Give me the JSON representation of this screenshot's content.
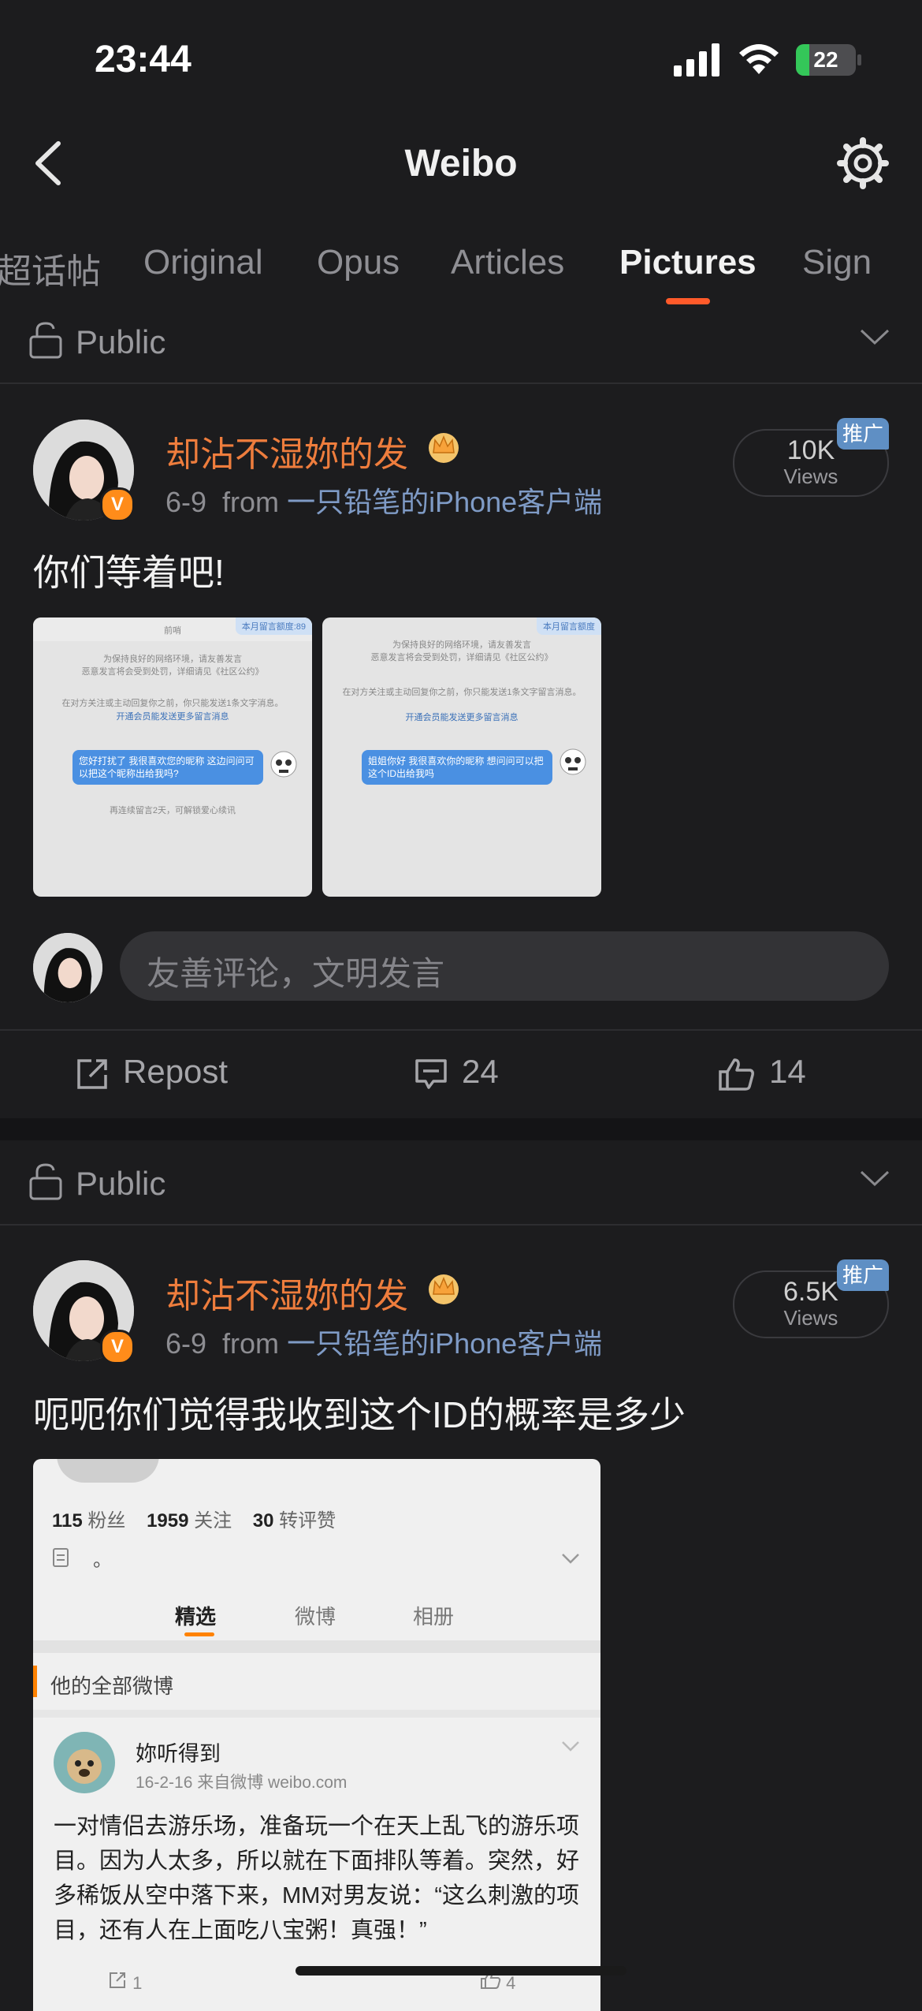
{
  "status_bar": {
    "time": "23:44",
    "battery": "22",
    "battery_level": 0.22
  },
  "nav": {
    "title": "Weibo"
  },
  "tabs": [
    {
      "label": "超话帖",
      "active": false
    },
    {
      "label": "Original",
      "active": false
    },
    {
      "label": "Opus",
      "active": false
    },
    {
      "label": "Articles",
      "active": false
    },
    {
      "label": "Pictures",
      "active": true
    },
    {
      "label": "Sign",
      "active": false
    }
  ],
  "colors": {
    "accent": "#ff5a2a",
    "username": "#ee7d3d",
    "link": "#7f9bc6",
    "background": "#1c1c1e"
  },
  "posts": [
    {
      "visibility": "Public",
      "username": "却沾不湿妳的发",
      "date": "6-9",
      "from_label": "from",
      "source": "一只铅笔的iPhone客户端",
      "views_count": "10K",
      "views_unit": "Views",
      "promo": "推广",
      "text": "你们等着吧!",
      "images": [
        {
          "tag": "本月留言额度:89",
          "top_label": "前哨",
          "notice_1": "为保持良好的网络环境，请友善发言",
          "notice_2": "恶意发言将会受到处罚，详细请见《社区公约》",
          "notice_3": "在对方关注或主动回复你之前，你只能发送1条文字消息。",
          "notice_4": "开通会员能发送更多留言消息",
          "bubble": "您好打扰了 我很喜欢您的昵称 这边问问可以把这个昵称出给我吗?",
          "footer": "再连续留言2天，可解锁爱心续讯"
        },
        {
          "tag": "本月留言额度",
          "top_label": "",
          "notice_1": "为保持良好的网络环境，请友善发言",
          "notice_2": "恶意发言将会受到处罚，详细请见《社区公约》",
          "notice_3": "在对方关注或主动回复你之前，你只能发送1条文字留言消息。",
          "notice_4": "开通会员能发送更多留言消息",
          "bubble": "姐姐你好 我很喜欢你的昵称 想问问可以把这个ID出给我吗",
          "footer": ""
        }
      ],
      "comment_placeholder": "友善评论，文明发言",
      "actions": {
        "repost": "Repost",
        "comments": "24",
        "likes": "14"
      }
    },
    {
      "visibility": "Public",
      "username": "却沾不湿妳的发",
      "date": "6-9",
      "from_label": "from",
      "source": "一只铅笔的iPhone客户端",
      "views_count": "6.5K",
      "views_unit": "Views",
      "promo": "推广",
      "text": "呃呃你们觉得我收到这个ID的概率是多少",
      "image": {
        "stats": [
          {
            "num": "115",
            "label": "粉丝"
          },
          {
            "num": "1959",
            "label": "关注"
          },
          {
            "num": "30",
            "label": "转评赞"
          }
        ],
        "bio": "。",
        "tabs": [
          "精选",
          "微博",
          "相册"
        ],
        "section": "他的全部微博",
        "inner_user": "妳听得到",
        "inner_meta": "16-2-16  来自微博 weibo.com",
        "inner_text": "一对情侣去游乐场，准备玩一个在天上乱飞的游乐项目。因为人太多，所以就在下面排队等着。突然，好多稀饭从空中落下来，MM对男友说：“这么刺激的项目，还有人在上面吃八宝粥！真强！”",
        "inner_repost": "1",
        "inner_likes": "4"
      }
    }
  ]
}
